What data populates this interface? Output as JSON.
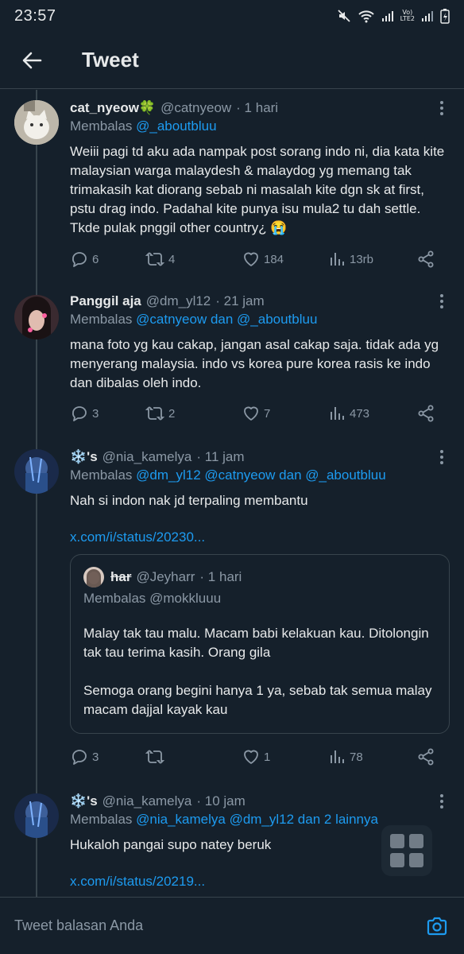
{
  "status_bar": {
    "time": "23:57",
    "network_top": "Vo)",
    "network_bottom": "LTE2"
  },
  "header": {
    "title": "Tweet"
  },
  "tweets": [
    {
      "name": "cat_nyeow🍀",
      "handle": "@catnyeow",
      "time": "· 1 hari",
      "reply_prefix": "Membalas ",
      "reply_to": "@_aboutbluu",
      "text": "Weiii pagi td aku ada nampak post sorang indo ni, dia kata kite malaysian warga malaydesh & malaydog yg memang tak trimakasih kat diorang sebab ni masalah kite dgn sk at first, pstu drag indo. Padahal kite punya isu mula2 tu dah settle. Tkde pulak pnggil other country¿ 😭",
      "replies": "6",
      "retweets": "4",
      "likes": "184",
      "views": "13rb"
    },
    {
      "name": "Panggil aja",
      "handle": "@dm_yl12",
      "time": "· 21 jam",
      "reply_prefix": "Membalas ",
      "reply_to": "@catnyeow dan @_aboutbluu",
      "text": "mana foto yg kau cakap, jangan asal cakap saja. tidak ada yg menyerang malaysia. indo vs korea pure korea rasis ke indo dan dibalas oleh indo.",
      "replies": "3",
      "retweets": "2",
      "likes": "7",
      "views": "473"
    },
    {
      "name": "❄️'s",
      "handle": "@nia_kamelya",
      "time": "· 11 jam",
      "reply_prefix": "Membalas ",
      "reply_to": "@dm_yl12 @catnyeow dan @_aboutbluu",
      "text": "Nah si indon nak jd terpaling membantu",
      "url": "x.com/i/status/20230...",
      "replies": "3",
      "retweets": "",
      "likes": "1",
      "views": "78",
      "quote": {
        "name": "har",
        "handle": "@Jeyharr",
        "time": "· 1 hari",
        "reply_line": "Membalas @mokkluuu",
        "text": "Malay tak tau malu. Macam babi kelakuan kau. Ditolongin tak tau terima kasih. Orang gila\n\nSemoga orang begini hanya 1 ya, sebab tak semua malay macam dajjal kayak kau"
      }
    },
    {
      "name": "❄️'s",
      "handle": "@nia_kamelya",
      "time": "· 10 jam",
      "reply_prefix": "Membalas ",
      "reply_to": "@nia_kamelya @dm_yl12 dan 2 lainnya",
      "text": "Hukaloh pangai supo natey beruk",
      "url": "x.com/i/status/20219..."
    }
  ],
  "composer": {
    "placeholder": "Tweet balasan Anda"
  },
  "colors": {
    "background": "#15202b",
    "link": "#1d9bf0",
    "muted": "#8b98a5",
    "divider": "#38444d"
  }
}
